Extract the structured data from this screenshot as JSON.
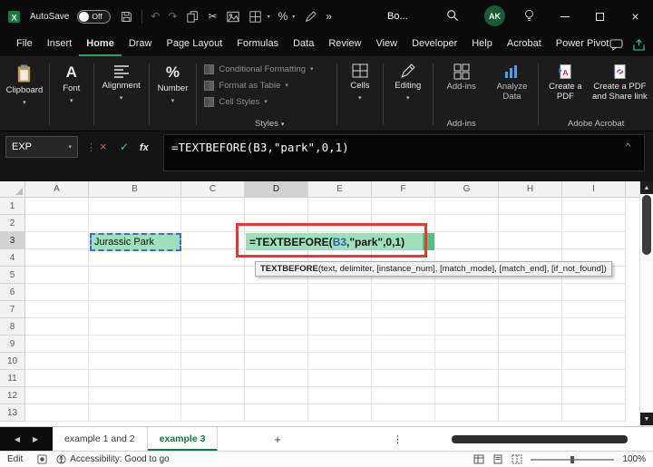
{
  "titlebar": {
    "autosave_label": "AutoSave",
    "autosave_state": "Off",
    "doc_title": "Bo...",
    "avatar_initials": "AK"
  },
  "menubar": {
    "items": [
      "File",
      "Insert",
      "Home",
      "Draw",
      "Page Layout",
      "Formulas",
      "Data",
      "Review",
      "View",
      "Developer",
      "Help",
      "Acrobat",
      "Power Pivot"
    ],
    "active": "Home"
  },
  "ribbon": {
    "clipboard_label": "Clipboard",
    "font_label": "Font",
    "font_icon_glyph": "A",
    "alignment_label": "Alignment",
    "number_label": "Number",
    "number_icon_glyph": "%",
    "styles": {
      "items": [
        "Conditional Formatting",
        "Format as Table",
        "Cell Styles"
      ],
      "label": "Styles"
    },
    "cells_label": "Cells",
    "editing_label": "Editing",
    "addins_button_label": "Add-ins",
    "addins_group_label": "Add-ins",
    "analyze_label": "Analyze Data",
    "pdf_label": "Create a PDF",
    "pdf_share_label": "Create a PDF and Share link",
    "acrobat_group_label": "Adobe Acrobat"
  },
  "formula_bar": {
    "name_box_value": "EXP",
    "cancel_glyph": "×",
    "enter_glyph": "✓",
    "fx_label": "fx",
    "formula": "=TEXTBEFORE(B3,\"park\",0,1)",
    "collapse_glyph": "^"
  },
  "grid": {
    "columns": [
      "A",
      "B",
      "C",
      "D",
      "E",
      "F",
      "G",
      "H",
      "I"
    ],
    "rows": [
      "1",
      "2",
      "3",
      "4",
      "5",
      "6",
      "7",
      "8",
      "9",
      "10",
      "11",
      "12",
      "13"
    ],
    "active_column": "D",
    "active_row": "3",
    "b3_value": "Jurassic Park",
    "d3_formula": {
      "prefix": "=TEXTBEFORE(",
      "ref": "B3",
      "suffix": ",\"park\",0,1)"
    },
    "tooltip": {
      "function_name": "TEXTBEFORE",
      "signature": "(text, delimiter, [instance_num], [match_mode], [match_end], [if_not_found])"
    }
  },
  "sheet_tabs": {
    "tabs": [
      {
        "label": "example 1 and 2",
        "active": false
      },
      {
        "label": "example 3",
        "active": true
      }
    ],
    "add_glyph": "+"
  },
  "status_bar": {
    "mode": "Edit",
    "accessibility_text": "Accessibility: Good to go",
    "zoom_value": "100%"
  },
  "colors": {
    "excel_green": "#107C41",
    "cell_highlight": "#9FE0BC",
    "annotation_red": "#E8372C",
    "reference_blue": "#2B5CAD"
  }
}
